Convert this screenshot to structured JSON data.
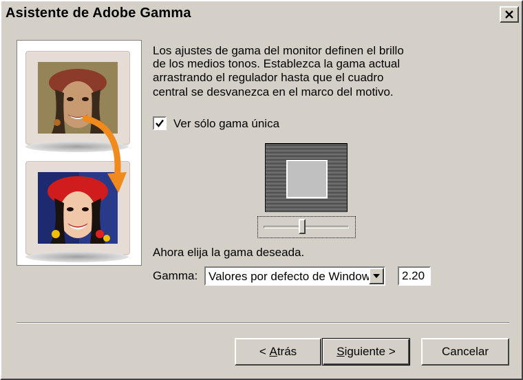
{
  "window": {
    "title": "Asistente de Adobe Gamma",
    "close_icon": "close-icon"
  },
  "intro": {
    "line1": "Los ajustes de gama del monitor definen el brillo",
    "line2": "de los medios tonos. Establezca la gama actual",
    "line3": "arrastrando el regulador hasta que el cuadro",
    "line4": "central se desvanezca en el marco del motivo."
  },
  "checkbox": {
    "label": "Ver sólo gama única",
    "checked": true
  },
  "slider": {
    "level": 0.45
  },
  "choose_label": "Ahora elija la gama deseada.",
  "gamma": {
    "label": "Gamma:",
    "selected": "Valores por defecto de Windows",
    "value": "2.20"
  },
  "buttons": {
    "back_prefix": "< ",
    "back_mnemonic": "A",
    "back_rest": "trás",
    "next_mnemonic": "S",
    "next_rest": "iguiente >",
    "cancel": "Cancelar"
  },
  "colors": {
    "face_bg": "#d4d0c8",
    "arrow": "#f08a1c"
  }
}
